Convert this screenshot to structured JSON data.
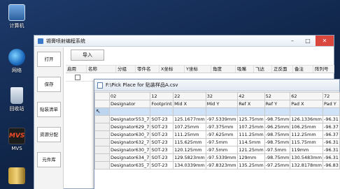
{
  "desktop": {
    "icons": [
      {
        "label": "计算机",
        "icon": "computer-icon"
      },
      {
        "label": "网络",
        "icon": "network-icon"
      },
      {
        "label": "回收站",
        "icon": "recycle-bin-icon"
      },
      {
        "label": "MVS",
        "icon": "mvs-app-icon"
      },
      {
        "label": "",
        "icon": "book-icon"
      }
    ]
  },
  "main_window": {
    "title": "锡膏喷射编程系统",
    "controls": {
      "minimize": "–",
      "maximize": "□",
      "close": "✕"
    },
    "sidebar": [
      "打开",
      "保存",
      "贴装清单",
      "资源分配",
      "元件库"
    ],
    "import_label": "导入",
    "columns": [
      "启用",
      "名称",
      "分组",
      "零件名",
      "X坐标",
      "Y坐标",
      "角度",
      "吸嘴",
      "飞达",
      "正反面",
      "备注",
      "阵列号"
    ]
  },
  "csv_window": {
    "title": "F:\\Pick Place for 贴装样品A.csv",
    "header_numbers": [
      "02",
      "12",
      "22",
      "32",
      "42",
      "52",
      "62",
      "72"
    ],
    "header_names": [
      "Designator",
      "Footprint",
      "Mid X",
      "Mid Y",
      "Ref X",
      "Ref Y",
      "Pad X",
      "Pad Y"
    ],
    "rows": [
      [
        "Designator553_7",
        "SOT-23",
        "125.1677mm",
        "-97.5339mm",
        "125.75mm",
        "-98.75mm",
        "126.1336mm",
        "-96.31"
      ],
      [
        "Designator629_7",
        "SOT-23",
        "107.25mm",
        "-97.375mm",
        "107.25mm",
        "-96.25mm",
        "106.25mm",
        "-96.37"
      ],
      [
        "Designator630_7",
        "SOT-23",
        "111.25mm",
        "-97.625mm",
        "111.25mm",
        "-98.75mm",
        "112.25mm",
        "-96.37"
      ],
      [
        "Designator632_7",
        "SOT-23",
        "115.625mm",
        "-97.5mm",
        "114.5mm",
        "-98.75mm",
        "115.75mm",
        "-96.31"
      ],
      [
        "Designator630_7",
        "SOT-23",
        "120.125mm",
        "-97.5mm",
        "121.25mm",
        "-97.5mm",
        "119mm",
        "-96.31"
      ],
      [
        "Designator634_7",
        "SOT-23",
        "129.5823mm",
        "-97.5339mm",
        "129mm",
        "-98.75mm",
        "130.5483mm",
        "-96.31"
      ],
      [
        "Designator635_7",
        "SOT-23",
        "134.0339mm",
        "-97.8323mm",
        "135.25mm",
        "-97.25mm",
        "132.8178mm",
        "-96.83"
      ]
    ]
  }
}
